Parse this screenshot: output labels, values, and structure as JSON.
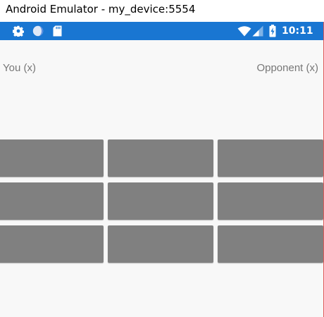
{
  "window": {
    "title": "Android Emulator - my_device:5554"
  },
  "status_bar": {
    "color": "#1976d2",
    "left_icons": [
      "gear-icon",
      "circle-icon",
      "sd-card-icon"
    ],
    "right_icons": [
      "wifi-icon",
      "signal-icon",
      "battery-charging-icon"
    ],
    "time": "10:11"
  },
  "game": {
    "player_label": "You (x)",
    "opponent_label": "Opponent (x)",
    "board": {
      "rows": 3,
      "columns": 3,
      "cell_color": "#808080",
      "cells": [
        "",
        "",
        "",
        "",
        "",
        "",
        "",
        "",
        ""
      ]
    }
  }
}
